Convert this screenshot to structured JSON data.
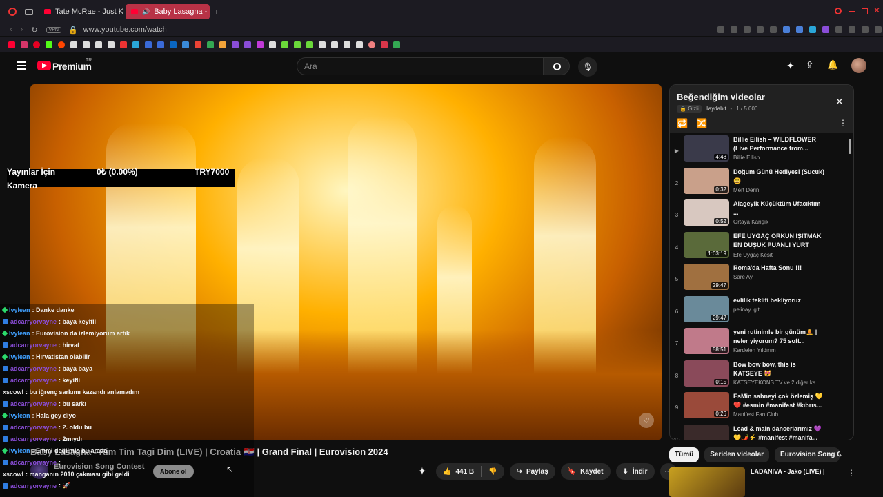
{
  "browser": {
    "tabs": [
      {
        "label": "Tate McRae - Just Keep W"
      },
      {
        "label": "Baby Lasagna - Rim Ti"
      }
    ],
    "new_tab": "+",
    "vpn": "VPN",
    "url": "www.youtube.com/watch"
  },
  "youtube": {
    "logo": "Premium",
    "logo_sup": "TR",
    "search_placeholder": "Ara"
  },
  "video": {
    "overlay_left_1": "Yayınlar İçin",
    "overlay_left_2": "Kamera",
    "overlay_mid": "0₺ (0.00%)",
    "overlay_right": "TRY7000",
    "title": "Baby Lasagna - Rim Tim Tagi Dim (LIVE) | Croatia 🇭🇷 | Grand Final | Eurovision 2024",
    "channel": "Eurovision Song Contest",
    "subscribe": "Abone ol",
    "likes": "441 B",
    "share": "Paylaş",
    "save": "Kaydet",
    "download": "İndir"
  },
  "chat": [
    {
      "user": "lvylean",
      "msg": ": Danke danke",
      "badge": "g",
      "color": "#40a0ff"
    },
    {
      "user": "adcarryorvayne",
      "msg": ": baya keyifli",
      "badge": "b",
      "color": "#8a4dd8"
    },
    {
      "user": "lvylean",
      "msg": ": Eurovision da izlemiyorum artık",
      "badge": "g",
      "color": "#40a0ff"
    },
    {
      "user": "adcarryorvayne",
      "msg": ": hirvat",
      "badge": "b",
      "color": "#8a4dd8"
    },
    {
      "user": "lvylean",
      "msg": ": Hırvatistan olabilir",
      "badge": "g",
      "color": "#40a0ff"
    },
    {
      "user": "adcarryorvayne",
      "msg": ": baya baya",
      "badge": "b",
      "color": "#8a4dd8"
    },
    {
      "user": "adcarryorvayne",
      "msg": ": keyifli",
      "badge": "b",
      "color": "#8a4dd8"
    },
    {
      "user": "xscowl",
      "msg": ": bu iğrenç sarkımı kazandı anlamadım",
      "badge": "",
      "color": "#e8e8e8"
    },
    {
      "user": "adcarryorvayne",
      "msg": ": bu sarkı",
      "badge": "b",
      "color": "#8a4dd8"
    },
    {
      "user": "lvylean",
      "msg": ": Hala gey diyo",
      "badge": "g",
      "color": "#40a0ff"
    },
    {
      "user": "adcarryorvayne",
      "msg": ": 2. oldu bu",
      "badge": "b",
      "color": "#8a4dd8"
    },
    {
      "user": "adcarryorvayne",
      "msg": ": 2mıydı",
      "badge": "b",
      "color": "#8a4dd8"
    },
    {
      "user": "lvylean",
      "msg": ": Emmi değilmiş bu arada",
      "badge": "g",
      "color": "#40a0ff"
    },
    {
      "user": "adcarryorvayne",
      "msg": ":",
      "badge": "b",
      "color": "#8a4dd8"
    },
    {
      "user": "xscowl",
      "msg": ": manganın 2010 çakması gibi geldi",
      "badge": "",
      "color": "#e8e8e8"
    },
    {
      "user": "adcarryorvayne",
      "msg": ": 🚀",
      "badge": "b",
      "color": "#8a4dd8"
    }
  ],
  "playlist": {
    "title": "Beğendiğim videolar",
    "privacy": "Gizli",
    "owner": "İlaydabit",
    "position": "1 / 5.000",
    "items": [
      {
        "idx": "▶",
        "title": "Billie Eilish – WILDFLOWER (Live Performance from...",
        "channel": "Billie Eilish",
        "duration": "4:48",
        "color": "#3a3a4a"
      },
      {
        "idx": "2",
        "title": "Doğum Günü Hediyesi (Sucuk) 😀",
        "channel": "Mert Derin",
        "duration": "0:32",
        "color": "#c9a08a"
      },
      {
        "idx": "3",
        "title": "Alageyik Küçüktüm Ufacıktım ...",
        "channel": "Ortaya Karışık",
        "duration": "0:52",
        "color": "#d8c8c0"
      },
      {
        "idx": "4",
        "title": "EFE UYGAÇ ORKUN IŞITMAK EN DÜŞÜK PUANLI YURT DIŞI...",
        "channel": "Efe Uygaç Kesit",
        "duration": "1:03:19",
        "color": "#5a6a3a"
      },
      {
        "idx": "5",
        "title": "Roma'da Hafta Sonu !!!",
        "channel": "Sare Ay",
        "duration": "29:47",
        "color": "#a07040"
      },
      {
        "idx": "6",
        "title": "evlilik teklifi bekliyoruz",
        "channel": "pelinay igit",
        "duration": "29:47",
        "color": "#6a8a9a"
      },
      {
        "idx": "7",
        "title": "yeni rutinimle bir günüm🧘 | neler yiyorum? 75 soft...",
        "channel": "Kardelen Yıldırım",
        "duration": "58:51",
        "color": "#c07a8a"
      },
      {
        "idx": "8",
        "title": "Bow bow bow, this is KATSEYE 😻",
        "channel": "KATSEYEKONS TV ve 2 diğer ka...",
        "duration": "0:15",
        "color": "#8a4a5a"
      },
      {
        "idx": "9",
        "title": "EsMin sahneyi çok özlemiş 💛 ❤️ #esmin #manifest #kıbrıs...",
        "channel": "Manifest Fan Club",
        "duration": "0:26",
        "color": "#9a4a3a"
      },
      {
        "idx": "10",
        "title": "Lead & main dancerlarımız 💜 💛🌶️⚡ #manifest #manifa...",
        "channel": "",
        "duration": "0:20",
        "color": "#3a2a2a"
      }
    ]
  },
  "chips": [
    "Tümü",
    "Seriden videolar",
    "Eurovision Song Cont"
  ],
  "next_video": "LADANIVA - Jako (LIVE) |"
}
